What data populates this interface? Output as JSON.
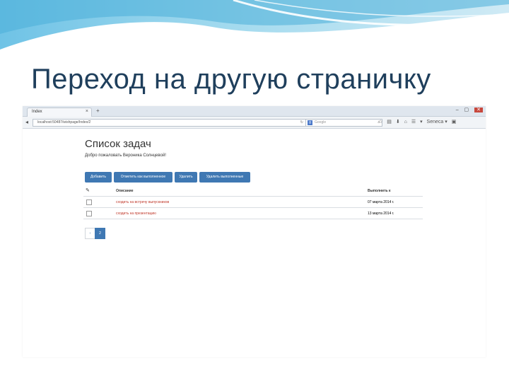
{
  "slide": {
    "title": "Переход на другую страничку"
  },
  "browser": {
    "tab_title": "Index",
    "tab_close": "×",
    "new_tab": "+",
    "win_min": "–",
    "win_max": "▢",
    "win_close": "✕",
    "back_arrow": "◂",
    "url": "localhost:50487/wishpage/Index/2",
    "reload": "↻",
    "search_placeholder": "Google",
    "search_engine_letter": "g",
    "search_icon": "⌕",
    "tools": [
      "☆",
      "▤",
      "⬇",
      "⌂",
      "☰",
      "▾",
      "Seneca ▾",
      "▣"
    ]
  },
  "page": {
    "heading": "Список задач",
    "welcome": "Добро пожаловать Вероника Солнцевой!",
    "buttons": [
      "Добавить",
      "Отметить как выполненное",
      "Удалить",
      "Удалить выполненные"
    ],
    "table": {
      "head_icon": "✎",
      "col_desc": "Описание",
      "col_due": "Выполнить к",
      "rows": [
        {
          "desc": "сходить на встречу выпускников",
          "due": "07 марта 2014 г."
        },
        {
          "desc": "сходить на презентацию",
          "due": "13 марта 2014 г."
        }
      ]
    },
    "pagination": {
      "prev": "‹",
      "current": "2"
    }
  },
  "colors": {
    "primary": "#3f78b3",
    "title": "#1f3f5c",
    "link": "#c0392b"
  }
}
